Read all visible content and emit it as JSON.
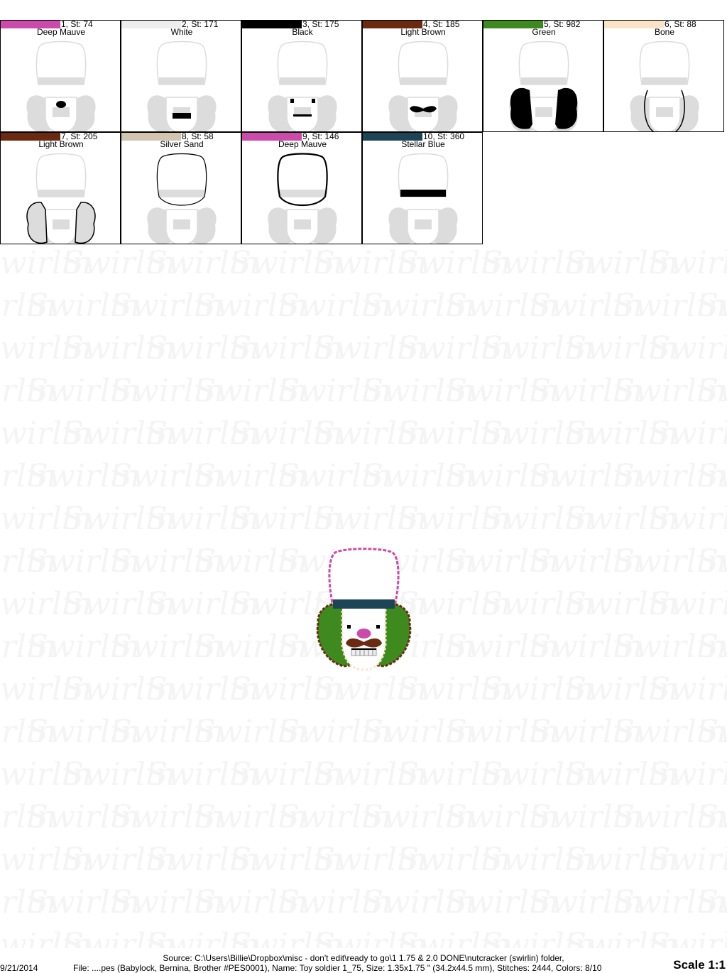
{
  "colors": {
    "deep_mauve": "#cc4aaa",
    "white": "#eeeeee",
    "black": "#000000",
    "light_brown": "#6b2a10",
    "green": "#3f8a1e",
    "bone": "#fbe3c8",
    "silver_sand": "#d2c4ae",
    "stellar_blue": "#1d4558",
    "ghost": "#dcdcdc",
    "watermark": "#f4f4f4"
  },
  "color_stops": [
    {
      "label": "1, St: 74",
      "name": "Deep Mauve",
      "color": "#cc4aaa",
      "highlight": "nose"
    },
    {
      "label": "2, St: 171",
      "name": "White",
      "color": "#eeeeee",
      "highlight": "teeth"
    },
    {
      "label": "3, St: 175",
      "name": "Black",
      "color": "#000000",
      "highlight": "eyes-mouth"
    },
    {
      "label": "4, St: 185",
      "name": "Light Brown",
      "color": "#6b2a10",
      "highlight": "mustache"
    },
    {
      "label": "5, St: 982",
      "name": "Green",
      "color": "#3f8a1e",
      "highlight": "hair-fill"
    },
    {
      "label": "6, St: 88",
      "name": "Bone",
      "color": "#fbe3c8",
      "highlight": "face-outline"
    },
    {
      "label": "7, St: 205",
      "name": "Light Brown",
      "color": "#6b2a10",
      "highlight": "hair-outline"
    },
    {
      "label": "8, St: 58",
      "name": "Silver Sand",
      "color": "#d2c4ae",
      "highlight": "hat-outline-thin"
    },
    {
      "label": "9, St: 146",
      "name": "Deep Mauve",
      "color": "#cc4aaa",
      "highlight": "hat-outline-thick"
    },
    {
      "label": "10, St: 360",
      "name": "Stellar Blue",
      "color": "#1d4558",
      "highlight": "hat-band"
    }
  ],
  "watermark_word": "Swirlin",
  "footer": {
    "date": "9/21/2014",
    "source_line": "Source: C:\\Users\\Billie\\Dropbox\\misc - don't edit\\ready to go\\1 1.75 & 2.0 DONE\\nutcracker (swirlin) folder,",
    "file_line": "File: ....pes (Babylock, Bernina, Brother #PES0001), Name: Toy soldier 1_75, Size: 1.35x1.75 \" (34.2x44.5 mm), Stitches: 2444, Colors: 8/10",
    "scale": "Scale 1:1"
  }
}
